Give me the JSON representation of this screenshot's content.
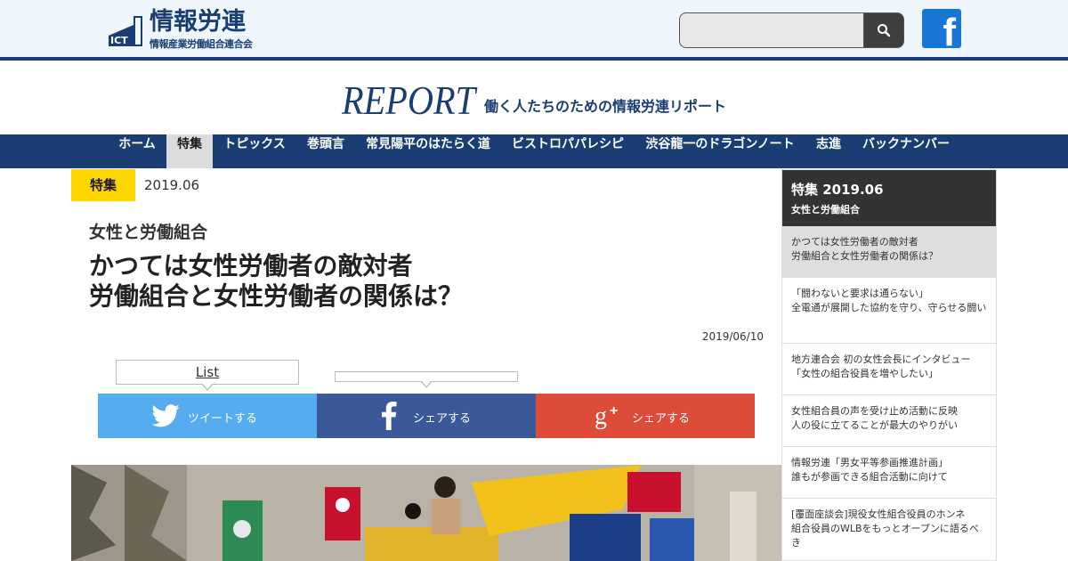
{
  "header": {
    "logo_ict": "ICT",
    "logo_main": "情報労連",
    "logo_sub": "情報産業労働組合連合会",
    "search": {
      "value": "",
      "placeholder": ""
    }
  },
  "brand": {
    "report_logo": "REPORT",
    "tagline": "働く人たちのための情報労連リポート"
  },
  "nav": {
    "items": [
      {
        "label": "ホーム"
      },
      {
        "label": "特集"
      },
      {
        "label": "トピックス"
      },
      {
        "label": "巻頭言"
      },
      {
        "label": "常見陽平のはたらく道"
      },
      {
        "label": "ビストロパパレシピ"
      },
      {
        "label": "渋谷龍一のドラゴンノート"
      },
      {
        "label": "志進"
      },
      {
        "label": "バックナンバー"
      }
    ],
    "active_index": 1
  },
  "article": {
    "category": "特集",
    "issue": "2019.06",
    "kicker": "女性と労働組合",
    "title_line1": "かつては女性労働者の敵対者",
    "title_line2": "労働組合と女性労働者の関係は？",
    "date": "2019/06/10"
  },
  "share": {
    "list_link": "List",
    "fb_count": "",
    "twitter_label": "ツイートする",
    "facebook_label": "シェアする",
    "googleplus_label": "シェアする"
  },
  "sidebar": {
    "title": "特集 2019.06",
    "subtitle": "女性と労働組合",
    "items": [
      {
        "line1": "かつては女性労働者の敵対者",
        "line2": "労働組合と女性労働者の関係は？"
      },
      {
        "line1": "「闘わないと要求は通らない」",
        "line2": "全電通が展開した協約を守り、守らせる闘い"
      },
      {
        "line1": "地方連合会 初の女性会長にインタビュー",
        "line2": "「女性の組合役員を増やしたい」"
      },
      {
        "line1": "女性組合員の声を受け止め活動に反映",
        "line2": "人の役に立てることが最大のやりがい"
      },
      {
        "line1": "情報労連「男女平等参画推進計画」",
        "line2": "誰もが参画できる組合活動に向けて"
      },
      {
        "line1": "[覆面座談会]現役女性組合役員のホンネ",
        "line2": "組合役員のWLBをもっとオープンに語るべき"
      }
    ],
    "active_index": 0
  },
  "colors": {
    "navy": "#1a3e73",
    "category_yellow": "#ffd500",
    "twitter": "#55acee",
    "facebook": "#3b5998",
    "googleplus": "#dd4b39"
  }
}
